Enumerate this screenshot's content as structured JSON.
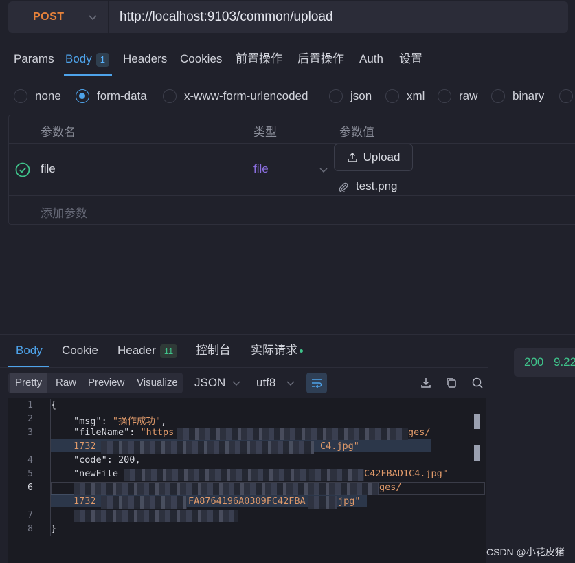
{
  "request": {
    "method": "POST",
    "url": "http://localhost:9103/common/upload"
  },
  "req_tabs": {
    "params": "Params",
    "body": "Body",
    "body_badge": "1",
    "headers": "Headers",
    "cookies": "Cookies",
    "pre": "前置操作",
    "post": "后置操作",
    "auth": "Auth",
    "settings": "设置"
  },
  "body_types": {
    "none": "none",
    "form_data": "form-data",
    "urlencoded": "x-www-form-urlencoded",
    "json": "json",
    "xml": "xml",
    "raw": "raw",
    "binary": "binary",
    "selected": "form-data"
  },
  "params_table": {
    "headers": [
      "参数名",
      "类型",
      "参数值"
    ],
    "row": {
      "name": "file",
      "type": "file",
      "upload_label": "Upload",
      "file_name": "test.png"
    },
    "add_placeholder": "添加参数"
  },
  "resp_tabs": {
    "body": "Body",
    "cookie": "Cookie",
    "header": "Header",
    "header_badge": "11",
    "console": "控制台",
    "actual_request": "实际请求"
  },
  "status": {
    "code": "200",
    "time": "9.22"
  },
  "view": {
    "modes": [
      "Pretty",
      "Raw",
      "Preview",
      "Visualize"
    ],
    "active_mode": "Pretty",
    "format": "JSON",
    "encoding": "utf8"
  },
  "code": {
    "line_numbers": [
      "1",
      "2",
      "3",
      "4",
      "5",
      "6",
      "7",
      "8"
    ],
    "open_brace": "{",
    "msg_key": "\"msg\"",
    "msg_value": "\"操作成功\"",
    "filename_key": "\"fileName\"",
    "filename_value_start": "\"https",
    "filename_value_mid": "ges/",
    "filename_line2_start": "1732",
    "filename_line2_end": "C4.jpg\"",
    "code_key": "\"code\"",
    "code_value": "200",
    "newfile_key": "\"newFile",
    "newfile_value_end": "C42FBAD1C4.jpg\"",
    "url_frag": "ges/",
    "url_line2_start": "1732",
    "url_line2_mid": "FA8764196A0309FC42FBA",
    "url_line2_end": "jpg\"",
    "close_brace": "}"
  },
  "watermark": "CSDN @小花皮猪"
}
